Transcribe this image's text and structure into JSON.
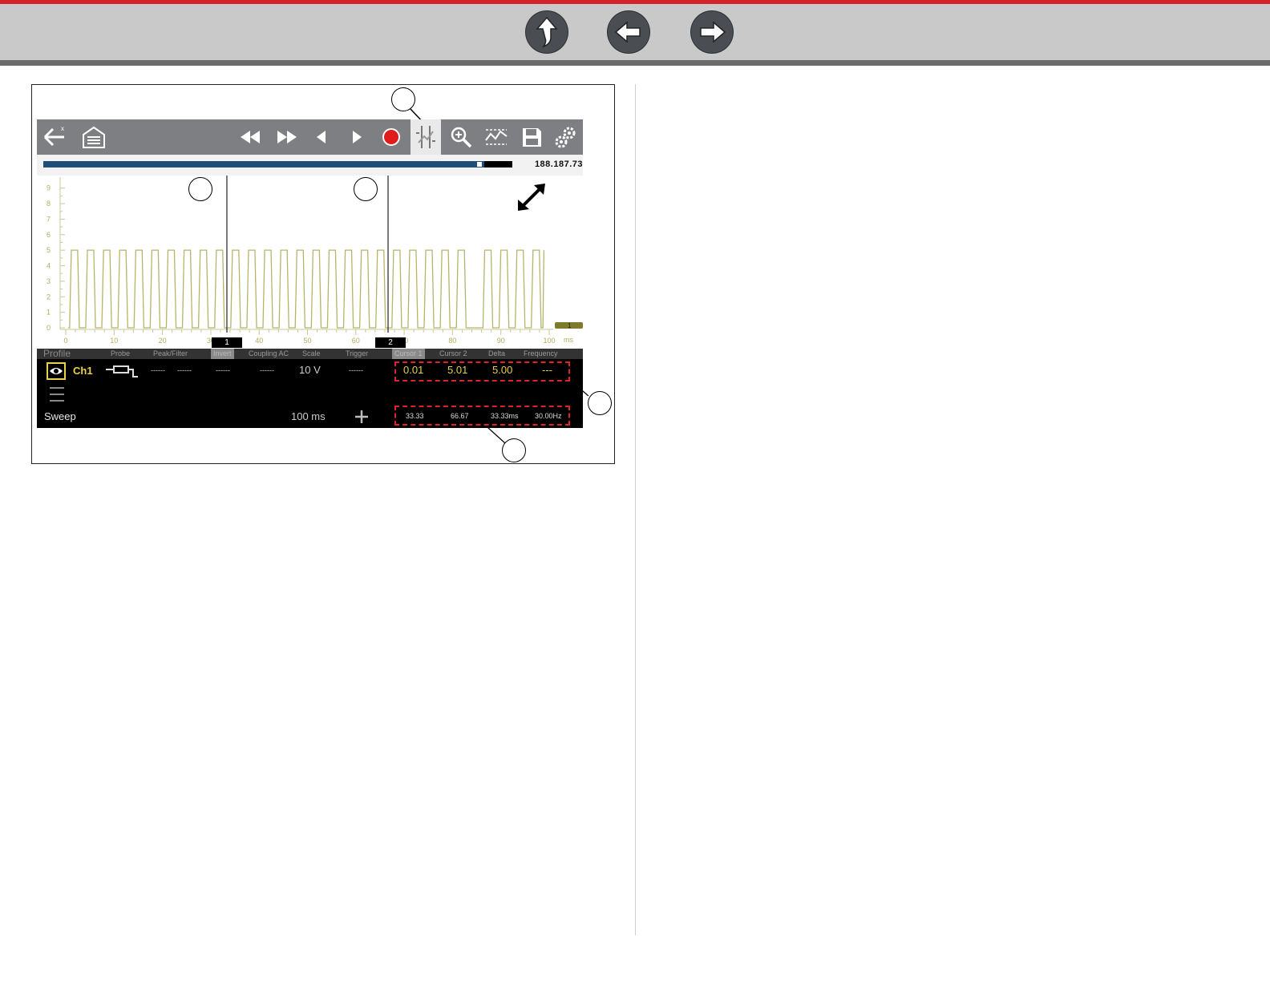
{
  "nav": {
    "buttons": [
      {
        "name": "up-arrow-icon"
      },
      {
        "name": "back-arrow-icon"
      },
      {
        "name": "forward-arrow-icon"
      }
    ],
    "colors": {
      "accent": "#d3222a",
      "bar": "#c9c9c9",
      "button": "#4a4d52"
    }
  },
  "scope": {
    "toolbar": {
      "icons": [
        "back-icon",
        "home-garage-icon",
        "rewind-icon",
        "fast-forward-icon",
        "step-back-icon",
        "step-forward-icon",
        "record-icon",
        "cursors-icon",
        "zoom-icon",
        "waveform-icon",
        "save-icon",
        "settings-icon"
      ],
      "active": "cursors-icon"
    },
    "progress": {
      "value": "188.187.73",
      "fill_fraction": 0.94
    },
    "plot": {
      "y_ticks": [
        "0",
        "1",
        "2",
        "3",
        "4",
        "5",
        "6",
        "7",
        "8",
        "9"
      ],
      "x_ticks": [
        "0",
        "10",
        "20",
        "30",
        "40",
        "50",
        "60",
        "70",
        "80",
        "90",
        "100"
      ],
      "x_unit": "ms",
      "cursor1_label": "1",
      "cursor2_label": "2",
      "channel_marker": "1",
      "trace_color": "#b7b46a",
      "cursor1_ms": 33.33,
      "cursor2_ms": 66.67
    },
    "header": {
      "profile": "Profile",
      "probe": "Probe",
      "peak_filter": "Peak/Filter",
      "invert": "Invert",
      "coupling": "Coupling AC",
      "scale": "Scale",
      "trigger": "Trigger",
      "cursor1": "Cursor 1",
      "cursor2": "Cursor 2",
      "delta": "Delta",
      "frequency": "Frequency"
    },
    "channel": {
      "name": "Ch1",
      "peak": "------",
      "filter": "------",
      "invert": "------",
      "coupling": "------",
      "scale": "10 V",
      "trigger": "------",
      "cursor1": "0.01",
      "cursor2": "5.01",
      "delta": "5.00",
      "frequency": "---"
    },
    "sweep": {
      "label": "Sweep",
      "value": "100 ms",
      "cursor1": "33.33",
      "cursor2": "66.67",
      "delta": "33.33ms",
      "frequency": "30.00Hz"
    }
  }
}
